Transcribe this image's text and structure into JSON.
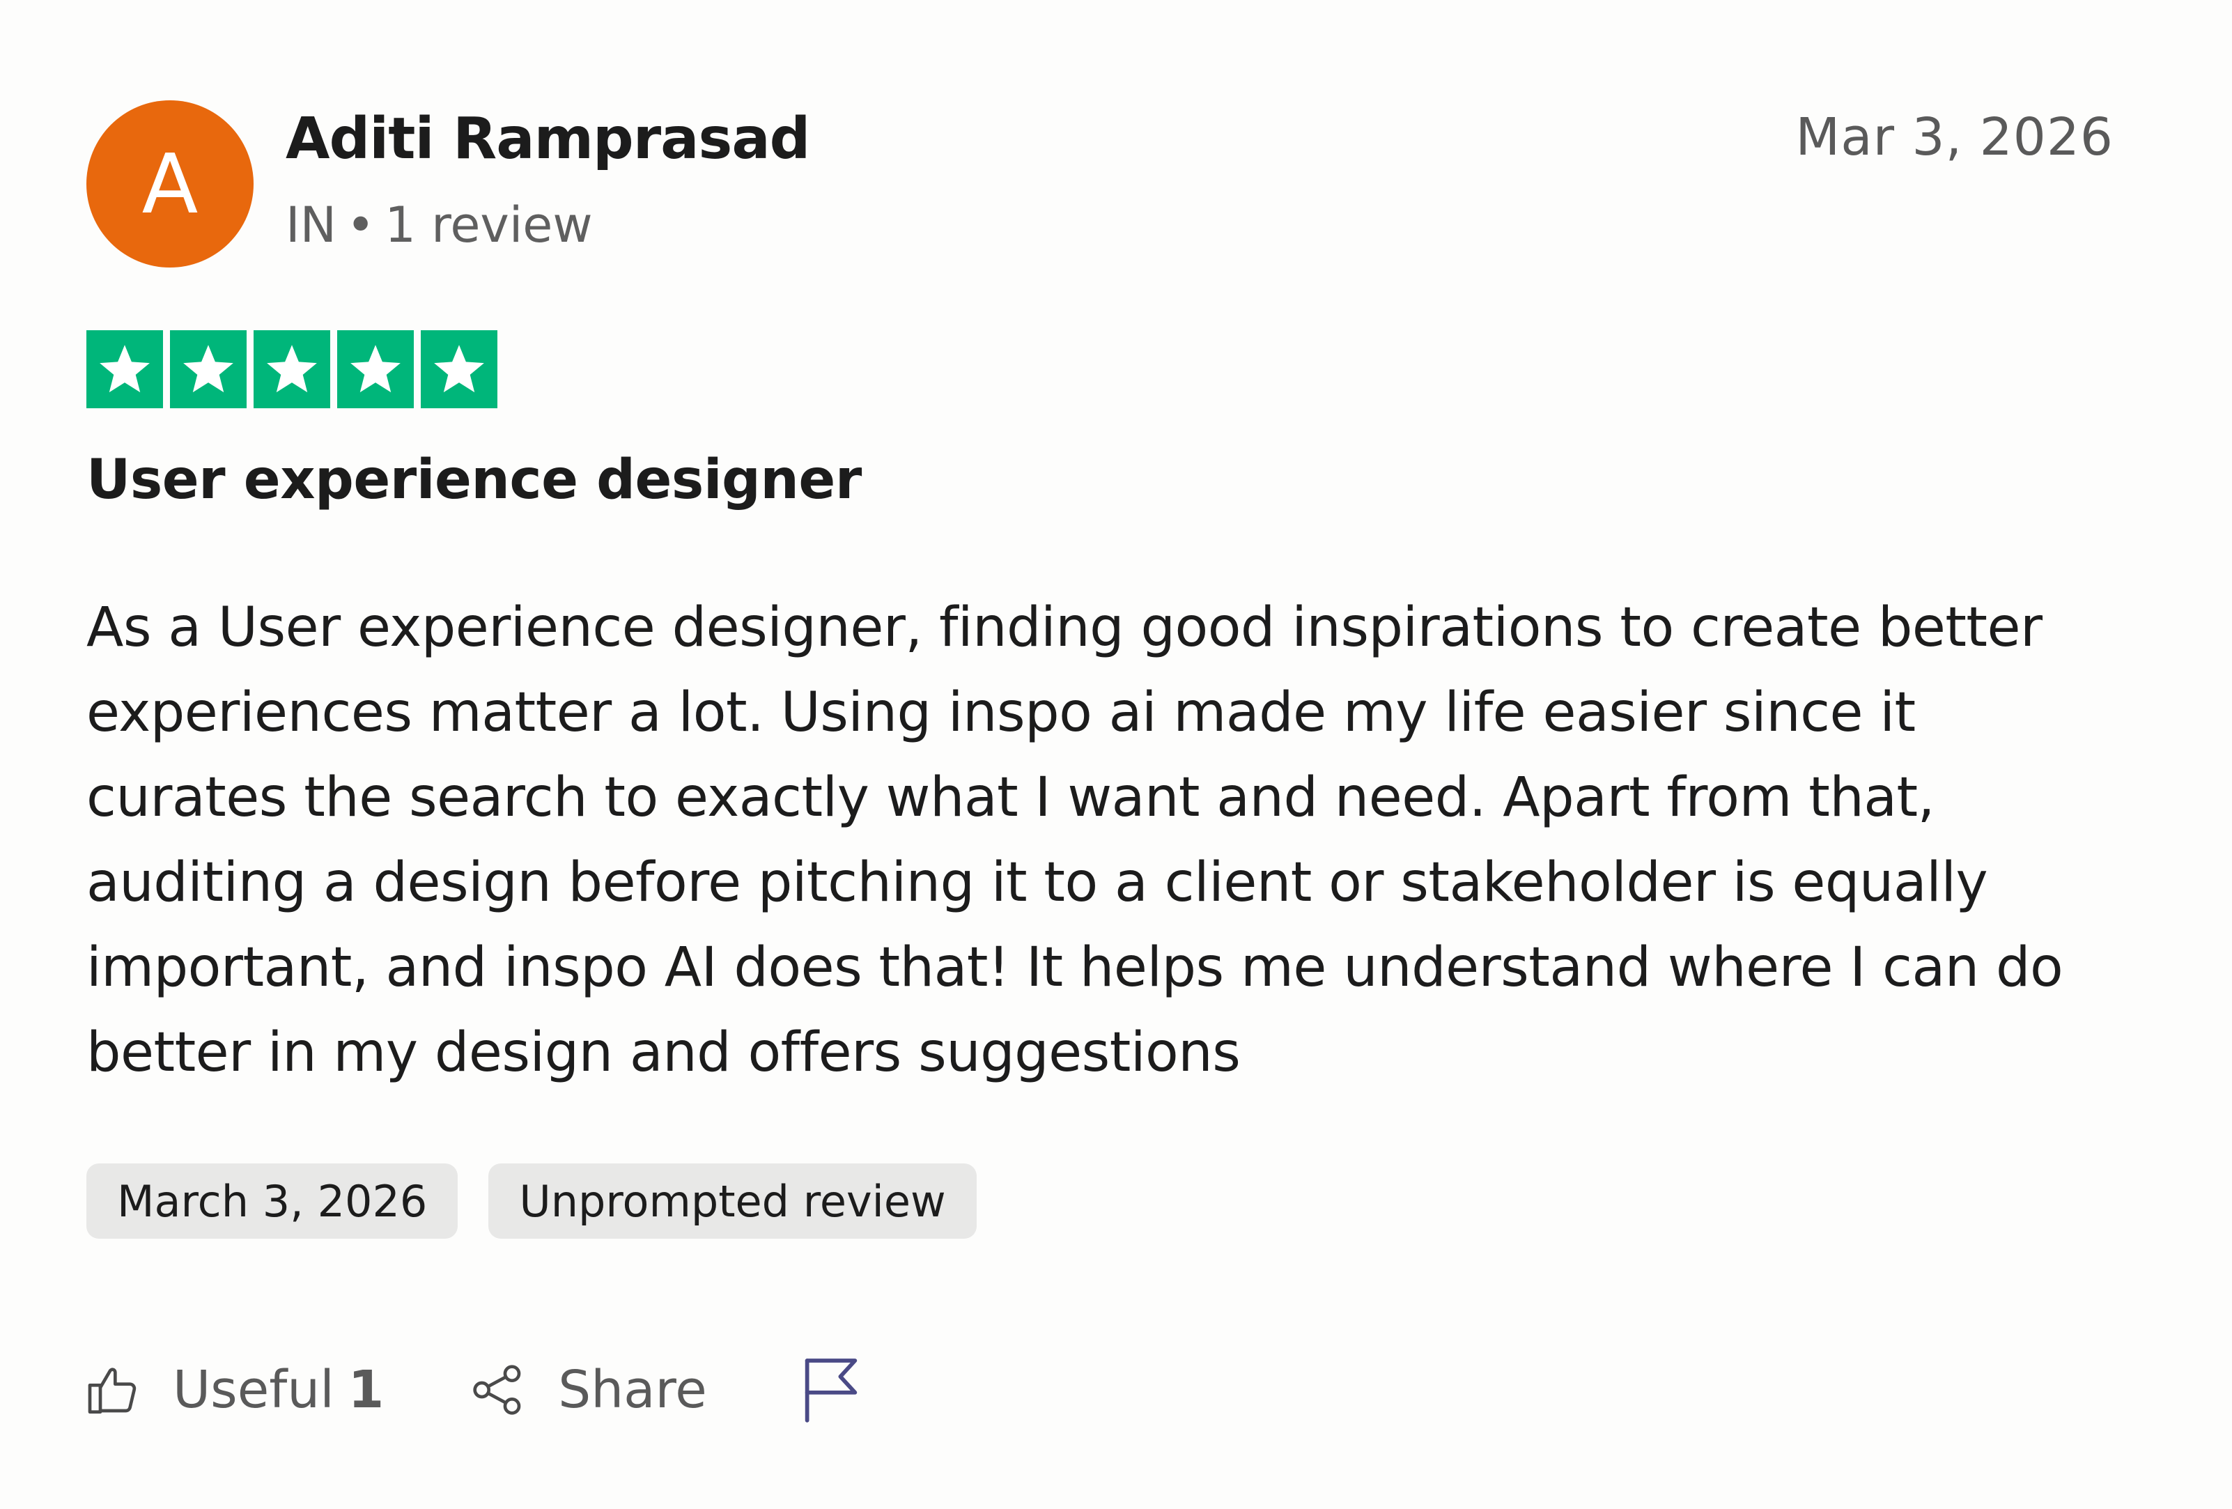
{
  "reviewer": {
    "avatar_letter": "A",
    "name": "Aditi Ramprasad",
    "country": "IN",
    "separator": "•",
    "review_count": "1 review"
  },
  "review": {
    "date_posted": "Mar 3, 2026",
    "rating": 5,
    "rating_color": "#00b67a",
    "title": "User experience designer",
    "body": "As a User experience designer, finding good inspirations to create better experiences matter a lot. Using inspo ai made my life easier since it curates the search to exactly what I want and need. Apart from that, auditing a design before pitching it to a client or stakeholder is equally important, and inspo AI does that! It helps me understand where I can do better in my design and offers suggestions",
    "tags": {
      "experience_date": "March 3, 2026",
      "review_type": "Unprompted review"
    }
  },
  "actions": {
    "useful_label": "Useful",
    "useful_count": "1",
    "share_label": "Share",
    "useful_icon": "thumbs-up-icon",
    "share_icon": "share-icon",
    "report_icon": "flag-icon"
  },
  "colors": {
    "avatar_bg": "#e8680d",
    "star_green": "#00b67a",
    "flag_color": "#4a4a86"
  }
}
